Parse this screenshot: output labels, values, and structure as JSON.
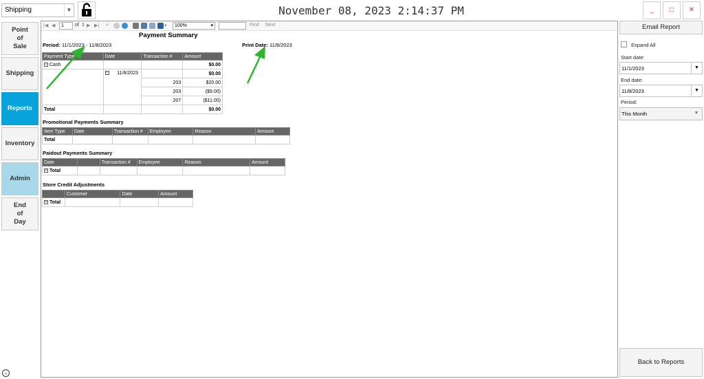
{
  "top": {
    "store_select": "Shipping",
    "clock": "November 08, 2023 2:14:37 PM",
    "minimize": "_",
    "maximize": "□",
    "close": "✕"
  },
  "nav": {
    "pos": [
      "Point",
      "of",
      "Sale"
    ],
    "shipping": "Shipping",
    "reports": "Reports",
    "inventory": "Inventory",
    "admin": "Admin",
    "eod": [
      "End",
      "of",
      "Day"
    ]
  },
  "toolbar": {
    "page": "1",
    "of": "of",
    "total_pages": "1",
    "zoom": "100%",
    "find": "Find",
    "next": "Next"
  },
  "report": {
    "title": "Payment Summary",
    "period_label": "Period:",
    "period_value": "11/1/2023 - 11/8/2023",
    "print_label": "Print Date:",
    "print_value": "11/8/2023",
    "payment_table": {
      "headers": [
        "Payment Type",
        "Date",
        "Transaction #",
        "Amount"
      ],
      "cash_label": "Cash",
      "cash_amount": "$0.00",
      "date": "11/6/2023",
      "date_amount": "$0.00",
      "rows": [
        {
          "txn": "203",
          "amount": "$20.00"
        },
        {
          "txn": "203",
          "amount": "($9.00)"
        },
        {
          "txn": "207",
          "amount": "($11.00)"
        }
      ],
      "total_label": "Total",
      "total_amount": "$0.00"
    },
    "promo": {
      "title": "Promotional Payments Summary",
      "headers": [
        "Item Type",
        "Date",
        "Transaction #",
        "Employee",
        "Reason",
        "Amount"
      ],
      "total_label": "Total"
    },
    "paidout": {
      "title": "Paidout Payments Summary",
      "headers": [
        "Date",
        "",
        "Transaction #",
        "Employee",
        "Reason",
        "Amount"
      ],
      "total_label": "Total"
    },
    "storecredit": {
      "title": "Store Credit Adjustments",
      "headers": [
        "",
        "Customer",
        "Date",
        "Amount"
      ],
      "total_label": "Total"
    }
  },
  "panel": {
    "email_button": "Email Report",
    "expand_all": "Expand All",
    "start_label": "Start date:",
    "start_value": "11/1/2023",
    "end_label": "End date:",
    "end_value": "11/8/2023",
    "period_label": "Period:",
    "period_value": "This Month",
    "back_button": "Back to Reports"
  },
  "colors": {
    "accent": "#09a3dc",
    "admin": "#a7d9ea",
    "header_gray": "#666666",
    "annotation_arrow": "#2db52d"
  }
}
